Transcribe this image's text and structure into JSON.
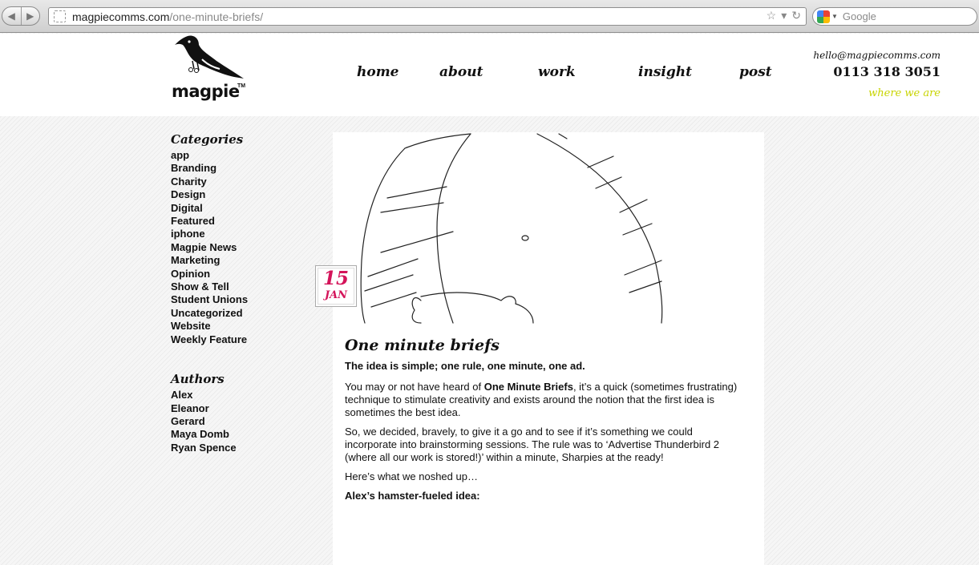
{
  "browser": {
    "url_domain": "magpiecomms.com",
    "url_path": "/one-minute-briefs/",
    "search_placeholder": "Google",
    "back_icon": "back-arrow-icon",
    "forward_icon": "forward-arrow-icon"
  },
  "site": {
    "logo_text": "magpie",
    "logo_tm": "TM",
    "nav": {
      "home": "home",
      "about": "about",
      "work": "work",
      "insight": "insight",
      "post": "post"
    },
    "contact": {
      "email": "hello@magpiecomms.com",
      "phone": "0113 318 3051",
      "where": "where we are"
    },
    "colors": {
      "accent": "#c8d400",
      "date": "#d4145a"
    }
  },
  "sidebar": {
    "categories_heading": "Categories",
    "categories": [
      "app",
      "Branding",
      "Charity",
      "Design",
      "Digital",
      "Featured",
      "iphone",
      "Magpie News",
      "Marketing",
      "Opinion",
      "Show & Tell",
      "Student Unions",
      "Uncategorized",
      "Website",
      "Weekly Feature"
    ],
    "authors_heading": "Authors",
    "authors": [
      "Alex",
      "Eleanor",
      "Gerard",
      "Maya Domb",
      "Ryan Spence"
    ]
  },
  "post": {
    "date_day": "15",
    "date_month": "JAN",
    "title": "One minute briefs",
    "lead": "The idea is simple; one rule, one minute, one ad.",
    "p1_before": "You may or not have heard of ",
    "p1_bold": "One Minute Briefs",
    "p1_after": ",  it’s a quick (sometimes frustrating) technique to stimulate creativity and exists around the notion that the first idea is sometimes the best idea.",
    "p2": "So, we decided, bravely, to give it a go and to see if it’s something we could incorporate into brainstorming sessions. The rule was to ‘Advertise Thunderbird 2 (where all our work is stored!)’ within a minute, Sharpies at the ready!",
    "p3": "Here’s what we noshed up…",
    "p4": "Alex’s hamster-fueled idea:"
  }
}
